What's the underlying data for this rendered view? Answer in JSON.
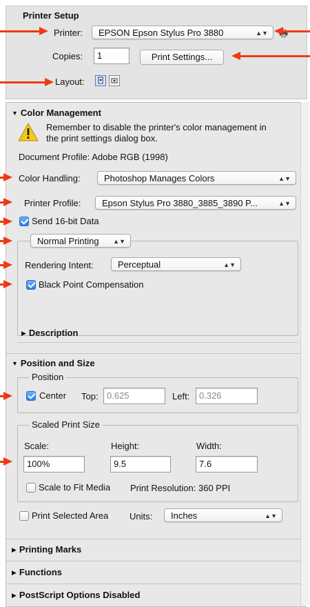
{
  "printer_setup": {
    "heading": "Printer Setup",
    "printer_label": "Printer:",
    "printer_value": "EPSON Epson Stylus Pro 3880",
    "copies_label": "Copies:",
    "copies_value": "1",
    "print_settings_button": "Print Settings...",
    "layout_label": "Layout:",
    "layout_options": [
      "portrait-icon",
      "landscape-icon"
    ]
  },
  "color_management": {
    "heading": "Color Management",
    "warning_text": "Remember to disable the printer's color management in the print settings dialog box.",
    "document_profile": "Document Profile: Adobe RGB (1998)",
    "color_handling_label": "Color Handling:",
    "color_handling_value": "Photoshop Manages Colors",
    "printer_profile_label": "Printer Profile:",
    "printer_profile_value": "Epson Stylus Pro 3880_3885_3890 P...",
    "send_16bit_label": "Send 16-bit Data",
    "send_16bit_checked": true,
    "printing_mode_value": "Normal Printing",
    "rendering_intent_label": "Rendering Intent:",
    "rendering_intent_value": "Perceptual",
    "black_point_label": "Black Point Compensation",
    "black_point_checked": true
  },
  "description": {
    "heading": "Description"
  },
  "position_and_size": {
    "heading": "Position and Size",
    "position_legend": "Position",
    "center_label": "Center",
    "center_checked": true,
    "top_label": "Top:",
    "top_value": "0.625",
    "left_label": "Left:",
    "left_value": "0.326",
    "scaled_legend": "Scaled Print Size",
    "scale_label": "Scale:",
    "scale_value": "100%",
    "height_label": "Height:",
    "height_value": "9.5",
    "width_label": "Width:",
    "width_value": "7.6",
    "scale_to_fit_label": "Scale to Fit Media",
    "scale_to_fit_checked": false,
    "print_resolution": "Print Resolution: 360 PPI",
    "print_selected_area_label": "Print Selected Area",
    "print_selected_area_checked": false,
    "units_label": "Units:",
    "units_value": "Inches"
  },
  "sections": {
    "printing_marks": "Printing Marks",
    "functions": "Functions",
    "postscript": "PostScript Options Disabled"
  },
  "colors": {
    "annotation_arrow": "#ee3a10",
    "checkbox_on": "#2a7fe8",
    "panel_bg": "#e8e8e8"
  }
}
